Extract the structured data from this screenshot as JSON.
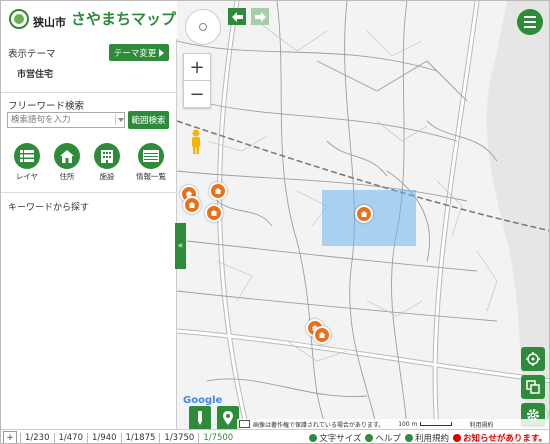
{
  "header": {
    "city_sub": "狭山市ロゴ",
    "city_name": "狭山市",
    "app_title": "さやまちマップ"
  },
  "sidebar": {
    "theme_label": "表示テーマ",
    "theme_button": "テーマ変更",
    "theme_name": "市営住宅",
    "freeword_label": "フリーワード検索",
    "search_placeholder": "検索語句を入力",
    "range_search": "範囲検索",
    "tools": [
      {
        "label": "レイヤ",
        "icon": "list-icon"
      },
      {
        "label": "住所",
        "icon": "home-icon"
      },
      {
        "label": "施設",
        "icon": "building-icon"
      },
      {
        "label": "情報一覧",
        "icon": "table-icon"
      }
    ],
    "keyword_label": "キーワードから探す",
    "collapse_glyph": "«"
  },
  "map": {
    "zoom_in": "+",
    "zoom_out": "−",
    "google_logo": "Google",
    "copyright": "画像は著作権で保護されている場合があります。",
    "scale_label": "100 m",
    "terms_small": "利用規約",
    "selection_color": "#6eb4eb",
    "marker_color": "#e8721c"
  },
  "bottom": {
    "expand": "+",
    "scales": [
      "1/230",
      "1/470",
      "1/940",
      "1/1875",
      "1/3750",
      "1/7500"
    ],
    "active_scale": "1/7500",
    "links": [
      {
        "label": "文字サイズ"
      },
      {
        "label": "ヘルプ"
      },
      {
        "label": "利用規約"
      }
    ],
    "notice": "お知らせがあります。"
  },
  "colors": {
    "accent": "#2e8b3a",
    "notice": "#dd0000"
  }
}
